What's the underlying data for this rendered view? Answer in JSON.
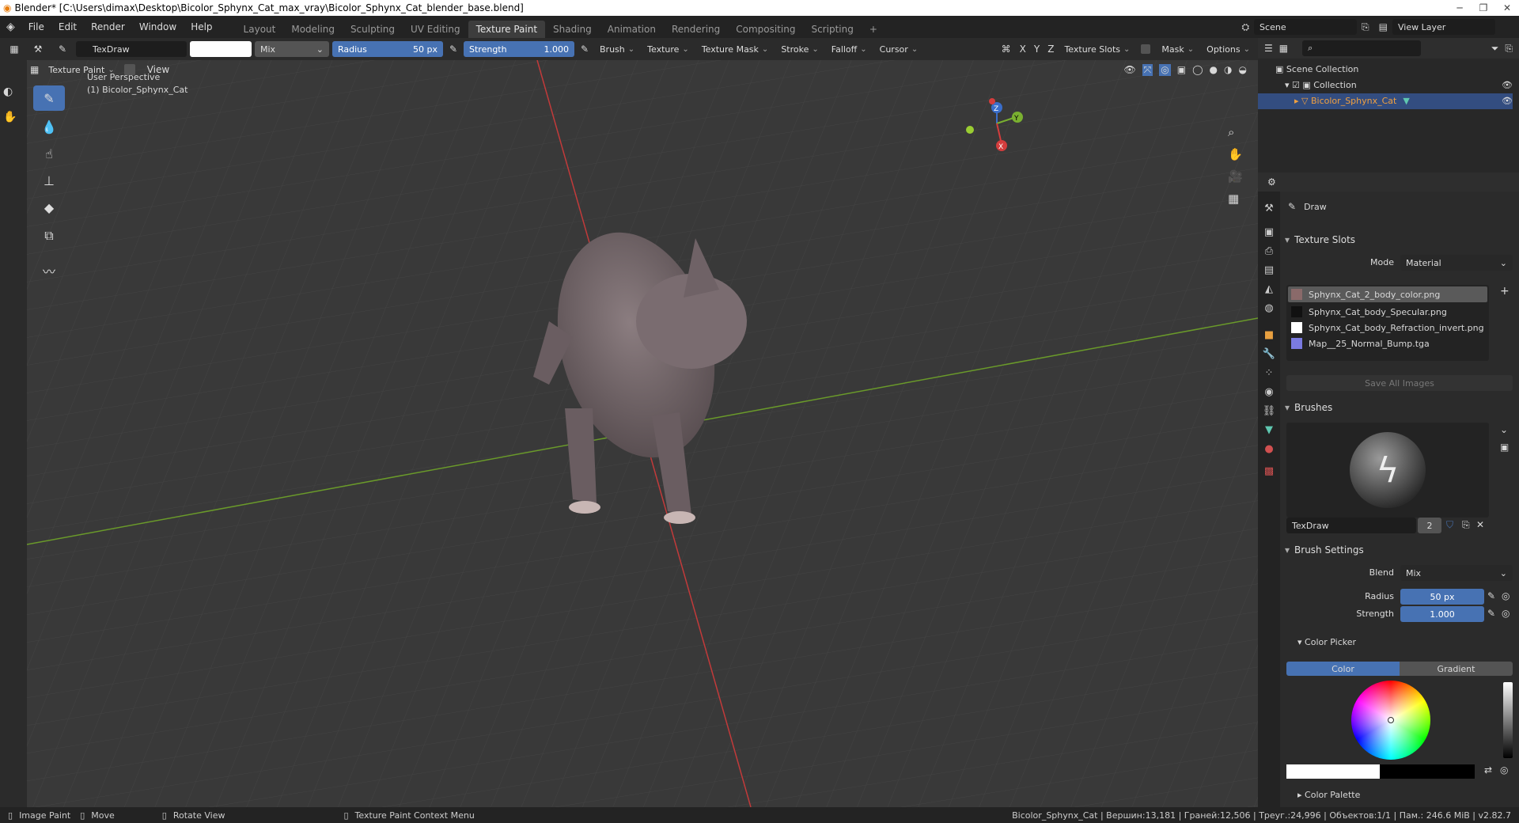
{
  "window": {
    "title": "Blender* [C:\\Users\\dimax\\Desktop\\Bicolor_Sphynx_Cat_max_vray\\Bicolor_Sphynx_Cat_blender_base.blend]"
  },
  "menu": [
    "File",
    "Edit",
    "Render",
    "Window",
    "Help"
  ],
  "workspace_tabs": [
    "Layout",
    "Modeling",
    "Sculpting",
    "UV Editing",
    "Texture Paint",
    "Shading",
    "Animation",
    "Rendering",
    "Compositing",
    "Scripting"
  ],
  "active_workspace": "Texture Paint",
  "scene": {
    "label": "Scene",
    "view_layer": "View Layer"
  },
  "tool_header": {
    "brush_name": "TexDraw",
    "blend_mode": "Mix",
    "radius_label": "Radius",
    "radius_value": "50 px",
    "strength_label": "Strength",
    "strength_value": "1.000",
    "menus": [
      "Brush",
      "Texture",
      "Texture Mask",
      "Stroke",
      "Falloff",
      "Cursor"
    ],
    "axes": [
      "X",
      "Y",
      "Z"
    ],
    "texture_slots": "Texture Slots",
    "mask": "Mask",
    "options": "Options"
  },
  "view_header": {
    "mode": "Texture Paint",
    "view": "View"
  },
  "viewport": {
    "perspective": "User Perspective",
    "object": "(1) Bicolor_Sphynx_Cat",
    "gizmo_axes": [
      "Z",
      "Y",
      "X"
    ]
  },
  "outliner": {
    "scene_collection": "Scene Collection",
    "collection": "Collection",
    "object": "Bicolor_Sphynx_Cat"
  },
  "properties": {
    "tool": "Draw",
    "texture_slots_title": "Texture Slots",
    "mode_label": "Mode",
    "mode_value": "Material",
    "slots": [
      "Sphynx_Cat_2_body_color.png",
      "Sphynx_Cat_body_Specular.png",
      "Sphynx_Cat_body_Refraction_invert.png",
      "Map__25_Normal_Bump.tga"
    ],
    "save_all": "Save All Images",
    "brushes_title": "Brushes",
    "brush_name": "TexDraw",
    "brush_users": "2",
    "brush_settings_title": "Brush Settings",
    "blend_label": "Blend",
    "blend_value": "Mix",
    "radius_label": "Radius",
    "radius_value": "50 px",
    "strength_label": "Strength",
    "strength_value": "1.000",
    "color_picker_title": "Color Picker",
    "color_tab": "Color",
    "gradient_tab": "Gradient",
    "color_palette": "Color Palette"
  },
  "status": {
    "left": [
      "Image Paint",
      "Move",
      "Rotate View",
      "Texture Paint Context Menu"
    ],
    "stats": "Bicolor_Sphynx_Cat | Вершин:13,181 | Граней:12,506 | Треуг.:24,996 | Объектов:1/1 | Пам.: 246.6 MiB | v2.82.7"
  },
  "colors": {
    "accent": "#4772b3",
    "grid_x": "#c23a3a",
    "grid_y": "#6a9a2a"
  }
}
